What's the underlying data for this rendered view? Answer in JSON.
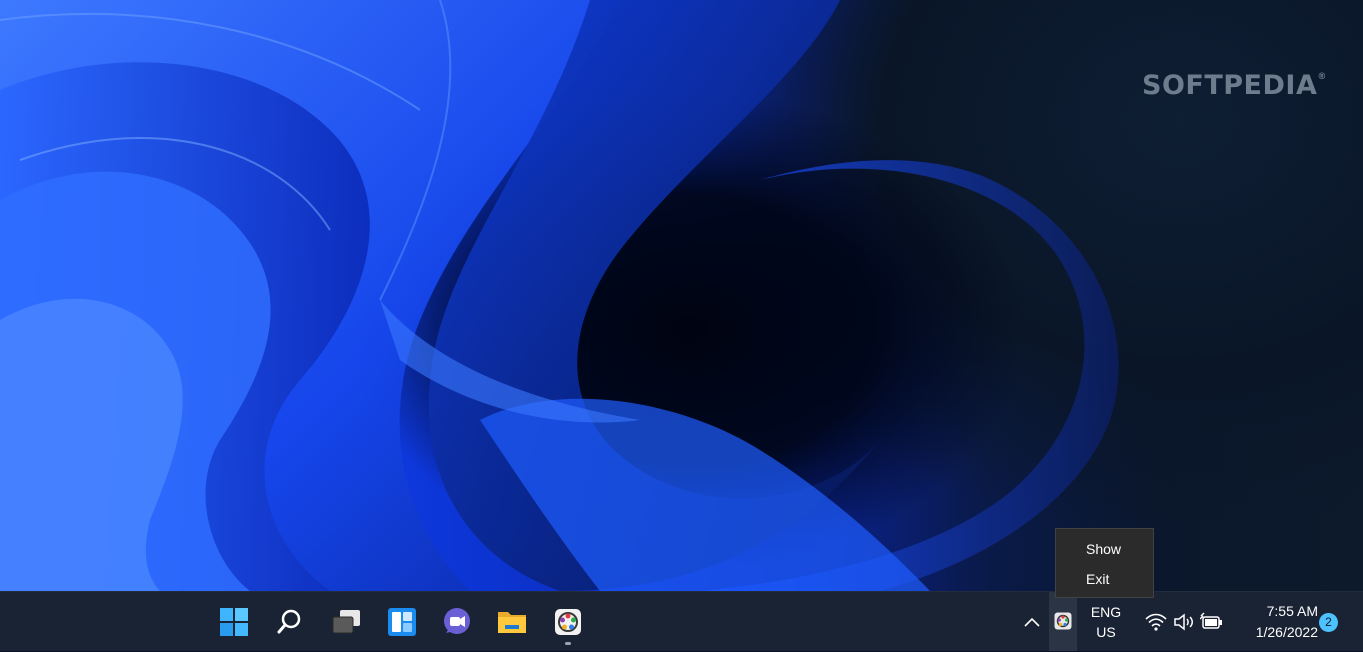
{
  "watermark": {
    "text": "SOFTPEDIA",
    "mark": "®"
  },
  "context_menu": {
    "items": [
      {
        "label": "Show"
      },
      {
        "label": "Exit"
      }
    ]
  },
  "taskbar": {
    "pinned": [
      {
        "icon": "windows-start-icon"
      },
      {
        "icon": "search-icon"
      },
      {
        "icon": "task-view-icon"
      },
      {
        "icon": "widgets-icon"
      },
      {
        "icon": "teams-chat-icon"
      },
      {
        "icon": "file-explorer-icon"
      },
      {
        "icon": "app-icon",
        "running": true
      }
    ],
    "tray": {
      "overflow_icon": "chevron-up-icon",
      "app_icon": "tray-app-icon",
      "language": {
        "line1": "ENG",
        "line2": "US"
      },
      "icons": [
        "wifi-icon",
        "volume-icon",
        "battery-icon"
      ],
      "clock": {
        "time": "7:55 AM",
        "date": "1/26/2022"
      },
      "notification_count": "2"
    }
  },
  "colors": {
    "taskbar_bg": "#1a2333",
    "menu_bg": "#2b2b2b",
    "badge": "#4cc2ff",
    "accent_blue": "#1f5cff"
  }
}
